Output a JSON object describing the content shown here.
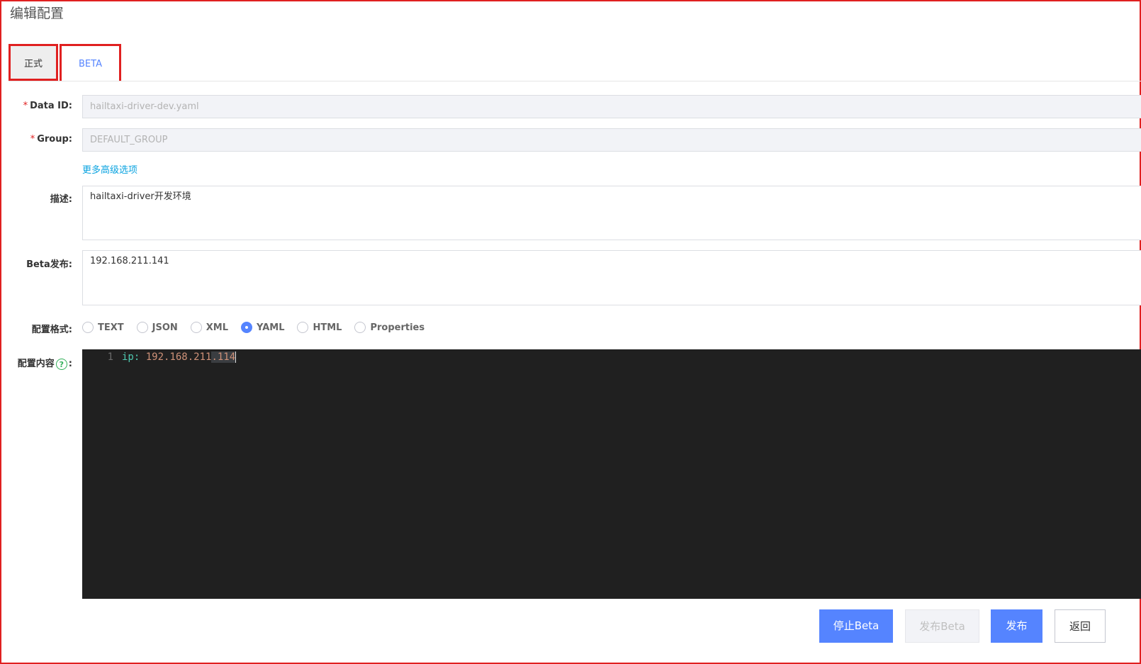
{
  "page_title": "编辑配置",
  "tabs": [
    {
      "label": "正式",
      "active": false
    },
    {
      "label": "BETA",
      "active": true
    }
  ],
  "form": {
    "data_id": {
      "label": "Data ID:",
      "required_mark": "*",
      "value": "hailtaxi-driver-dev.yaml"
    },
    "group": {
      "label": "Group:",
      "required_mark": "*",
      "value": "DEFAULT_GROUP"
    },
    "advanced_link": "更多高级选项",
    "description": {
      "label": "描述:",
      "value": "hailtaxi-driver开发环境"
    },
    "beta_publish": {
      "label": "Beta发布:",
      "value": "192.168.211.141"
    },
    "format": {
      "label": "配置格式:",
      "options": [
        "TEXT",
        "JSON",
        "XML",
        "YAML",
        "HTML",
        "Properties"
      ],
      "selected": "YAML"
    },
    "content": {
      "label_prefix": "配置内容",
      "help_glyph": "?",
      "label_suffix": ":",
      "line_number": "1",
      "code_key": "ip:",
      "code_value_plain": " 192.168.211",
      "code_value_selected": ".114"
    }
  },
  "buttons": {
    "stop_beta": "停止Beta",
    "publish_beta": "发布Beta",
    "publish": "发布",
    "back": "返回"
  },
  "colors": {
    "primary": "#5584ff",
    "highlight_border": "#e02020",
    "link": "#0aa3e0",
    "editor_bg": "#202020"
  }
}
